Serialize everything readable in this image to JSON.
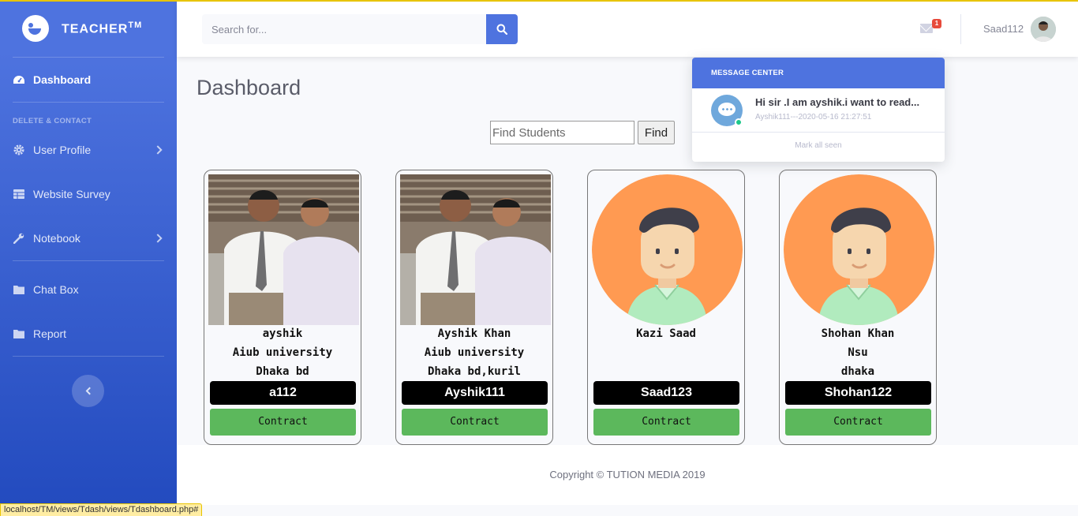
{
  "brand": {
    "name": "TEACHER",
    "tm": "TM"
  },
  "sidebar": {
    "items": [
      {
        "label": "Dashboard"
      },
      {
        "label": "User Profile"
      },
      {
        "label": "Website Survey"
      },
      {
        "label": "Notebook"
      },
      {
        "label": "Chat Box"
      },
      {
        "label": "Report"
      }
    ],
    "heading": "DELETE & CONTACT"
  },
  "topbar": {
    "search_placeholder": "Search for...",
    "alert_count": "1",
    "username": "Saad112"
  },
  "messages": {
    "title": "MESSAGE CENTER",
    "items": [
      {
        "text": "Hi sir .I am ayshik.i want to read...",
        "meta": "Ayshik111---2020-05-16 21:27:51"
      }
    ],
    "footer": "Mark all seen"
  },
  "main": {
    "title": "Dashboard",
    "find_placeholder": "Find Students",
    "find_label": "Find"
  },
  "students": [
    {
      "name": "ayshik",
      "university": "Aiub university",
      "location": "Dhaka bd",
      "id": "a112",
      "button": "Contract"
    },
    {
      "name": "Ayshik Khan",
      "university": "Aiub university",
      "location": "Dhaka bd,kuril",
      "id": "Ayshik111",
      "button": "Contract"
    },
    {
      "name": "Kazi Saad",
      "university": "",
      "location": "",
      "id": "Saad123",
      "button": "Contract"
    },
    {
      "name": "Shohan Khan",
      "university": "Nsu",
      "location": "dhaka",
      "id": "Shohan122",
      "button": "Contract"
    }
  ],
  "footer": {
    "text": "Copyright © TUTION MEDIA 2019"
  },
  "statusbar": {
    "url": "localhost/TM/views/Tdash/views/Tdashboard.php#"
  },
  "colors": {
    "primary": "#4e73df",
    "success": "#5cb85c",
    "danger": "#e74a3b"
  }
}
